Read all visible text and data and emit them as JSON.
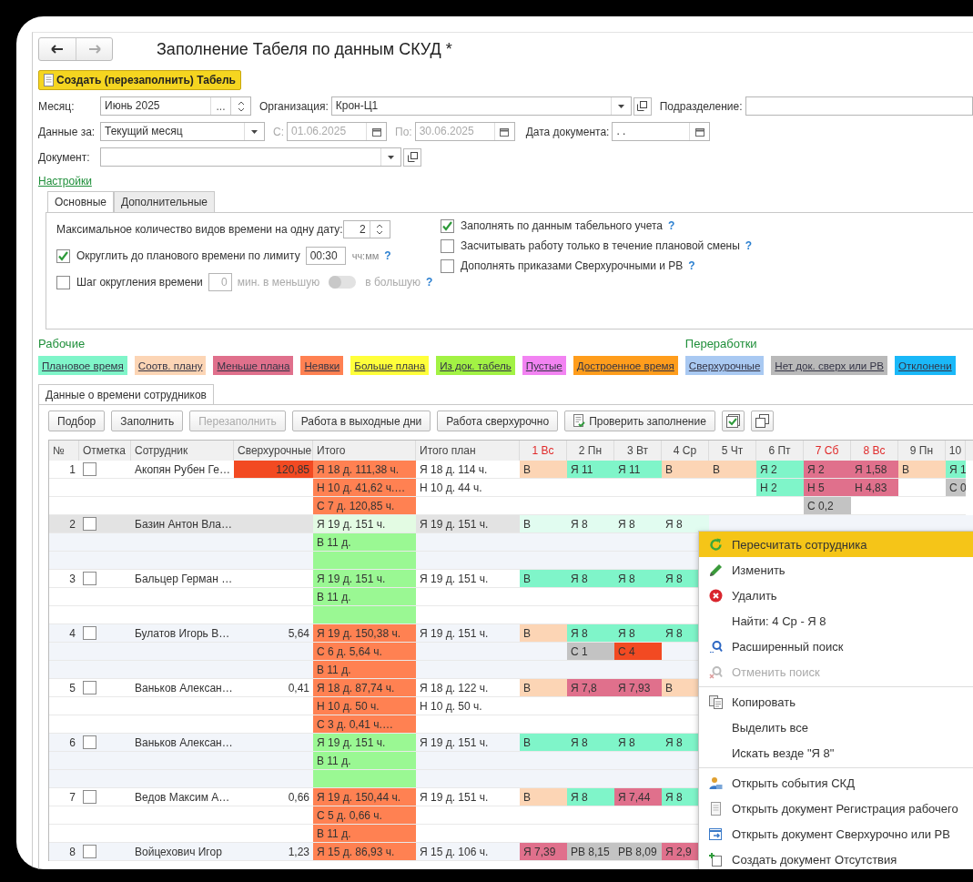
{
  "window": {
    "title": "Заполнение Табеля по данным СКУД *"
  },
  "create_button": {
    "label": "Создать (перезаполнить) Табель"
  },
  "form": {
    "month": {
      "label": "Месяц:",
      "value": "Июнь 2025",
      "select_button": "..."
    },
    "organization": {
      "label": "Организация:",
      "value": "Крон-Ц1"
    },
    "department": {
      "label": "Подразделение:"
    },
    "period": {
      "label": "Данные за:",
      "value": "Текущий месяц"
    },
    "date_from": {
      "label": "С:",
      "value": "01.06.2025",
      "disabled": true
    },
    "date_to": {
      "label": "По:",
      "value": "30.06.2025",
      "disabled": true
    },
    "doc_date": {
      "label": "Дата документа:",
      "value": ". ."
    },
    "document": {
      "label": "Документ:"
    }
  },
  "settings_link": "Настройки",
  "settings_tabs": [
    {
      "label": "Основные",
      "selected": true
    },
    {
      "label": "Дополнительные",
      "selected": false
    }
  ],
  "settings": {
    "max_kinds": {
      "label": "Максимальное количество видов времени на одну дату:",
      "value": "2"
    },
    "round": {
      "label": "Округлить до планового времени по лимиту",
      "checked": true,
      "value": "00:30",
      "unit": "чч:мм",
      "help": "?"
    },
    "step": {
      "label": "Шаг округления времени",
      "checked": false,
      "value": "0",
      "less": "мин. в меньшую",
      "more": "в большую",
      "switch_on": false,
      "help": "?"
    },
    "options": [
      {
        "label": "Заполнять по данным табельного учета",
        "checked": true,
        "help": "?"
      },
      {
        "label": "Засчитывать работу только в течение плановой смены",
        "checked": false,
        "help": "?"
      },
      {
        "label": "Дополнять приказами Сверхурочными и РВ",
        "checked": false,
        "help": "?"
      }
    ]
  },
  "legend": [
    {
      "title": "Рабочие",
      "items": [
        {
          "label": "Плановое время",
          "color": "#7ff5c9"
        },
        {
          "label": "Соотв. плану",
          "color": "#fcd5b5"
        },
        {
          "label": "Меньше плана",
          "color": "#e0708c"
        },
        {
          "label": "Неявки",
          "color": "#ff8152"
        },
        {
          "label": "Больше плана",
          "color": "#ffff3a"
        },
        {
          "label": "Из док. табель",
          "color": "#a2f244"
        },
        {
          "label": "Пустые",
          "color": "#f283f2"
        },
        {
          "label": "Достроенное время",
          "color": "#ff9d1c"
        }
      ]
    },
    {
      "title": "Переработки",
      "items": [
        {
          "label": "Сверхурочные",
          "color": "#a9c9f2"
        },
        {
          "label": "Нет док. сверх или РВ",
          "color": "#b9b9b9"
        },
        {
          "label": "Отклонени",
          "color": "#1ab8f8"
        }
      ]
    }
  ],
  "data_tab": {
    "label": "Данные о времени сотрудников",
    "selected": true
  },
  "toolbar": [
    {
      "kind": "text",
      "label": "Подбор",
      "disabled": false
    },
    {
      "kind": "text",
      "label": "Заполнить",
      "disabled": false
    },
    {
      "kind": "text",
      "label": "Перезаполнить",
      "disabled": true
    },
    {
      "kind": "text",
      "label": "Работа в выходные дни",
      "disabled": false
    },
    {
      "kind": "text",
      "label": "Работа сверхурочно",
      "disabled": false
    },
    {
      "kind": "check",
      "label": "Проверить заполнение",
      "disabled": false
    },
    {
      "kind": "checklist",
      "disabled": false
    },
    {
      "kind": "windows",
      "disabled": false
    }
  ],
  "table": {
    "columns": [
      "№",
      "Отметка",
      "Сотрудник",
      "Сверхурочные",
      "Итого",
      "Итого план"
    ],
    "days": [
      {
        "label": "1 Вс",
        "weekend": true
      },
      {
        "label": "2 Пн",
        "weekend": false
      },
      {
        "label": "3 Вт",
        "weekend": false
      },
      {
        "label": "4 Ср",
        "weekend": false
      },
      {
        "label": "5 Чт",
        "weekend": false
      },
      {
        "label": "6 Пт",
        "weekend": false
      },
      {
        "label": "7 Сб",
        "weekend": true
      },
      {
        "label": "8 Вс",
        "weekend": true
      },
      {
        "label": "9 Пн",
        "weekend": false
      },
      {
        "label": "10",
        "weekend": false
      }
    ],
    "rows": [
      {
        "number": "1",
        "checked": false,
        "name": "Акопян Рубен Ге…",
        "overtime": {
          "text": "120,85",
          "color": "#f24a22"
        },
        "selected": false,
        "lines": [
          {
            "total": {
              "text": "Я 18 д. 111,38 ч.",
              "color": "#ff8152"
            },
            "plan": "Я 18 д. 114 ч.",
            "days": {
              "day_1": {
                "text": "В",
                "color": "#fcd5b5"
              },
              "day_2": {
                "text": "Я 11",
                "color": "#7ff5c9"
              },
              "day_3": {
                "text": "Я 11",
                "color": "#7ff5c9"
              },
              "day_4": {
                "text": "В",
                "color": "#fcd5b5"
              },
              "day_5": {
                "text": "В",
                "color": "#fcd5b5"
              },
              "day_6": {
                "text": "Я 2",
                "color": "#7ff5c9"
              },
              "day_7": {
                "text": "Я 2",
                "color": "#e0708c"
              },
              "day_8": {
                "text": "Я 1,58",
                "color": "#e0708c"
              },
              "day_9": {
                "text": "В",
                "color": "#fcd5b5"
              },
              "day_10": {
                "text": "Я 1",
                "color": "#7ff5c9"
              }
            }
          },
          {
            "total": {
              "text": "Н 10 д. 41,62 ч.…",
              "color": "#ff8152"
            },
            "plan": "Н 10 д. 44 ч.",
            "days": {
              "day_6": {
                "text": "Н 2",
                "color": "#7ff5c9"
              },
              "day_7": {
                "text": "Н 5",
                "color": "#e0708c"
              },
              "day_8": {
                "text": "Н 4,83",
                "color": "#e0708c"
              },
              "day_10": {
                "text": "С 0",
                "color": "#c3c3c3"
              }
            }
          },
          {
            "total": {
              "text": "С 7 д. 120,85 ч.",
              "color": "#ff8152"
            },
            "days": {
              "day_7": {
                "text": "С 0,2",
                "color": "#c3c3c3"
              }
            }
          }
        ]
      },
      {
        "number": "2",
        "checked": false,
        "name": "Базин Антон Вла…",
        "selected": true,
        "lines": [
          {
            "total": {
              "text": "Я 19 д. 151 ч.",
              "color": "#e3fbe3"
            },
            "plan": "Я 19 д. 151 ч.",
            "days": {
              "day_1": {
                "text": "В",
                "color": "#e1fcf0"
              },
              "day_2": {
                "text": "Я 8",
                "color": "#e1fcf0"
              },
              "day_3": {
                "text": "Я 8",
                "color": "#e1fcf0"
              },
              "day_4": {
                "text": "Я 8",
                "color": "#e1fcf0"
              }
            }
          },
          {
            "total": {
              "text": "В 11 д.",
              "color": "#9af893"
            }
          },
          {
            "total": {
              "color": "#9af893"
            }
          }
        ]
      },
      {
        "number": "3",
        "checked": false,
        "name": "Бальцер Герман …",
        "selected": false,
        "lines": [
          {
            "total": {
              "text": "Я 19 д. 151 ч.",
              "color": "#9af893"
            },
            "plan": "Я 19 д. 151 ч.",
            "days": {
              "day_1": {
                "text": "В",
                "color": "#7ff5c9"
              },
              "day_2": {
                "text": "Я 8",
                "color": "#7ff5c9"
              },
              "day_3": {
                "text": "Я 8",
                "color": "#7ff5c9"
              },
              "day_4": {
                "text": "Я 8",
                "color": "#7ff5c9"
              }
            }
          },
          {
            "total": {
              "text": "В 11 д.",
              "color": "#9af893"
            }
          },
          {
            "total": {
              "color": "#9af893"
            }
          }
        ]
      },
      {
        "number": "4",
        "checked": false,
        "name": "Булатов Игорь В…",
        "overtime": {
          "text": "5,64"
        },
        "selected": false,
        "lines": [
          {
            "total": {
              "text": "Я 19 д. 150,38 ч.",
              "color": "#ff8152"
            },
            "plan": "Я 19 д. 151 ч.",
            "days": {
              "day_1": {
                "text": "В",
                "color": "#fcd5b5"
              },
              "day_2": {
                "text": "Я 8",
                "color": "#7ff5c9"
              },
              "day_3": {
                "text": "Я 8",
                "color": "#7ff5c9"
              },
              "day_4": {
                "text": "Я 8",
                "color": "#7ff5c9"
              }
            }
          },
          {
            "total": {
              "text": "С 6 д. 5,64 ч.",
              "color": "#ff8152"
            },
            "days": {
              "day_2": {
                "text": "С 1",
                "color": "#c3c3c3"
              },
              "day_3": {
                "text": "С 4",
                "color": "#f24a22"
              }
            }
          },
          {
            "total": {
              "text": "В 11 д.",
              "color": "#ff8152"
            }
          }
        ]
      },
      {
        "number": "5",
        "checked": false,
        "name": "Ваньков Алексан…",
        "overtime": {
          "text": "0,41"
        },
        "selected": false,
        "lines": [
          {
            "total": {
              "text": "Я 18 д. 87,74 ч.",
              "color": "#ff8152"
            },
            "plan": "Я 18 д. 122 ч.",
            "days": {
              "day_1": {
                "text": "В",
                "color": "#fcd5b5"
              },
              "day_2": {
                "text": "Я 7,8",
                "color": "#e0708c"
              },
              "day_3": {
                "text": "Я 7,93",
                "color": "#e0708c"
              },
              "day_4": {
                "text": "В",
                "color": "#fcd5b5"
              }
            }
          },
          {
            "total": {
              "text": "Н 10 д. 50 ч.",
              "color": "#ff8152"
            },
            "plan": "Н 10 д. 50 ч."
          },
          {
            "total": {
              "text": "С 3 д. 0,41 ч.…",
              "color": "#ff8152"
            }
          }
        ]
      },
      {
        "number": "6",
        "checked": false,
        "name": "Ваньков Алексан…",
        "selected": false,
        "lines": [
          {
            "total": {
              "text": "Я 19 д. 151 ч.",
              "color": "#9af893"
            },
            "plan": "Я 19 д. 151 ч.",
            "days": {
              "day_1": {
                "text": "В",
                "color": "#7ff5c9"
              },
              "day_2": {
                "text": "Я 8",
                "color": "#7ff5c9"
              },
              "day_3": {
                "text": "Я 8",
                "color": "#7ff5c9"
              },
              "day_4": {
                "text": "Я 8",
                "color": "#7ff5c9"
              }
            }
          },
          {
            "total": {
              "text": "В 11 д.",
              "color": "#9af893"
            }
          },
          {
            "total": {
              "color": "#9af893"
            }
          }
        ]
      },
      {
        "number": "7",
        "checked": false,
        "name": "Ведов Максим А…",
        "overtime": {
          "text": "0,66"
        },
        "selected": false,
        "lines": [
          {
            "total": {
              "text": "Я 19 д. 150,44 ч.",
              "color": "#ff8152"
            },
            "plan": "Я 19 д. 151 ч.",
            "days": {
              "day_1": {
                "text": "В",
                "color": "#fcd5b5"
              },
              "day_2": {
                "text": "Я 8",
                "color": "#7ff5c9"
              },
              "day_3": {
                "text": "Я 7,44",
                "color": "#e0708c"
              },
              "day_4": {
                "text": "Я 8",
                "color": "#7ff5c9"
              }
            }
          },
          {
            "total": {
              "text": "С 5 д. 0,66 ч.",
              "color": "#ff8152"
            }
          },
          {
            "total": {
              "text": "В 11 д.",
              "color": "#ff8152"
            }
          }
        ]
      },
      {
        "number": "8",
        "checked": false,
        "name": "Войцехович Игор",
        "overtime": {
          "text": "1,23"
        },
        "selected": false,
        "lines": [
          {
            "total": {
              "text": "Я 15 д. 86,93 ч.",
              "color": "#ff8152"
            },
            "plan": "Я 15 д. 106 ч.",
            "days": {
              "day_1": {
                "text": "Я 7,39",
                "color": "#e0708c"
              },
              "day_2": {
                "text": "РВ 8,15",
                "color": "#c3c3c3"
              },
              "day_3": {
                "text": "РВ 8,09",
                "color": "#c3c3c3"
              },
              "day_4": {
                "text": "Я 2,9",
                "color": "#e0708c"
              }
            }
          }
        ]
      }
    ]
  },
  "context_menu": {
    "groups": [
      [
        {
          "label": "Пересчитать сотрудника",
          "selected": true,
          "disabled": false
        },
        {
          "label": "Изменить",
          "selected": false,
          "disabled": false
        },
        {
          "label": "Удалить",
          "selected": false,
          "disabled": false
        },
        {
          "label": "Найти: 4 Ср - Я 8",
          "selected": false,
          "disabled": false
        },
        {
          "label": "Расширенный поиск",
          "selected": false,
          "disabled": false
        },
        {
          "label": "Отменить поиск",
          "selected": false,
          "disabled": true
        }
      ],
      [
        {
          "label": "Копировать",
          "selected": false,
          "disabled": false
        },
        {
          "label": "Выделить все",
          "selected": false,
          "disabled": false
        },
        {
          "label": "Искать везде \"Я 8\"",
          "selected": false,
          "disabled": false
        }
      ],
      [
        {
          "label": "Открыть события СКД",
          "selected": false,
          "disabled": false
        },
        {
          "label": "Открыть документ Регистрация рабочего",
          "selected": false,
          "disabled": false
        },
        {
          "label": "Открыть документ Сверхурочно или РВ",
          "selected": false,
          "disabled": false
        },
        {
          "label": "Создать документ Отсутствия",
          "selected": false,
          "disabled": false
        }
      ]
    ]
  }
}
